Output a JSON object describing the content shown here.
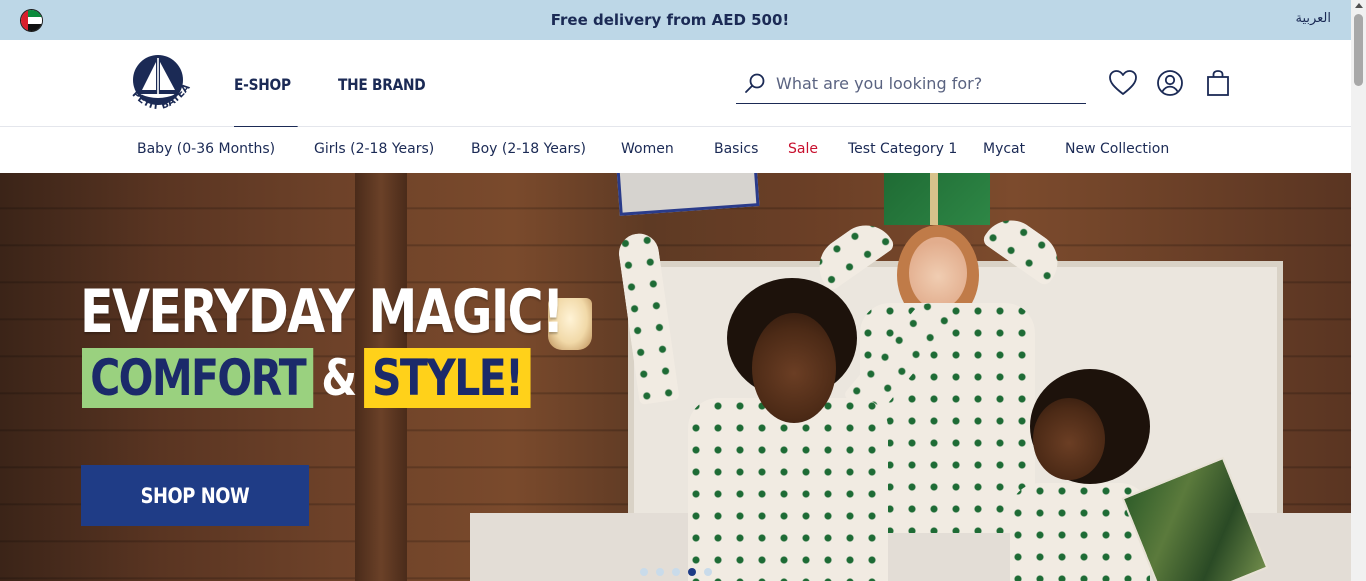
{
  "promo": {
    "flag_icon": "uae-flag-icon",
    "text": "Free delivery from AED 500!",
    "language_link": "العربية"
  },
  "header": {
    "logo_icon": "petit-bateau-logo",
    "logo_text": "PETIT BATEAU",
    "main_nav": [
      {
        "label": "E-SHOP",
        "active": true
      },
      {
        "label": "THE BRAND",
        "active": false
      }
    ],
    "search": {
      "placeholder": "What are you looking for?",
      "value": ""
    },
    "icons": [
      "heart-icon",
      "user-icon",
      "shopping-bag-icon"
    ]
  },
  "category_nav": {
    "items": [
      {
        "label": "Baby (0-36 Months)"
      },
      {
        "label": "Girls (2-18 Years)"
      },
      {
        "label": "Boy (2-18 Years)"
      },
      {
        "label": "Women"
      },
      {
        "label": "Basics"
      },
      {
        "label": "Sale",
        "color": "#c8102e"
      },
      {
        "label": "Test Category 1"
      },
      {
        "label": "Mycat"
      },
      {
        "label": "New Collection"
      }
    ]
  },
  "hero": {
    "headline": "EVERYDAY MAGIC!",
    "sub_part1": "COMFORT",
    "sub_amp": "&",
    "sub_part2": "STYLE!",
    "cta_label": "SHOP NOW",
    "slides_total": 5,
    "active_slide": 4,
    "colors": {
      "cta": "#1f3c86",
      "green_chip": "#9ad17f",
      "yellow_chip": "#ffd11a"
    }
  },
  "colors": {
    "navy": "#1b2a55",
    "promo_bg": "#bdd7e7",
    "sale": "#c8102e"
  }
}
